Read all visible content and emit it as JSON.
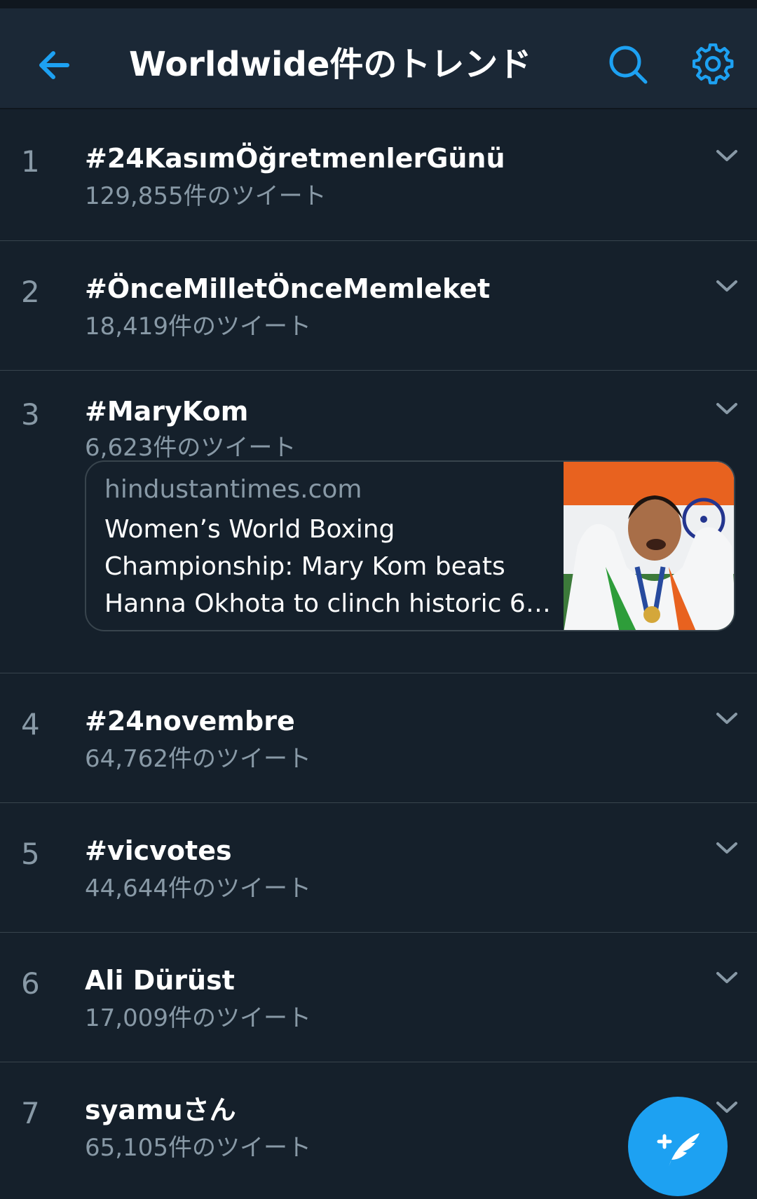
{
  "header": {
    "title": "Worldwide件のトレンド",
    "back_icon": "arrow-left-icon",
    "search_icon": "search-icon",
    "settings_icon": "gear-icon"
  },
  "accent_color": "#1da1f2",
  "trends": [
    {
      "rank": "1",
      "name": "#24KasımÖğretmenlerGünü",
      "count": "129,855件のツイート"
    },
    {
      "rank": "2",
      "name": "#ÖnceMilletÖnceMemleket",
      "count": "18,419件のツイート"
    },
    {
      "rank": "3",
      "name": "#MaryKom",
      "count": "6,623件のツイート"
    },
    {
      "rank": "4",
      "name": "#24novembre",
      "count": "64,762件のツイート"
    },
    {
      "rank": "5",
      "name": "#vicvotes",
      "count": "44,644件のツイート"
    },
    {
      "rank": "6",
      "name": "Ali Dürüst",
      "count": "17,009件のツイート"
    },
    {
      "rank": "7",
      "name": "syamuさん",
      "count": "65,105件のツイート"
    }
  ],
  "news_card": {
    "domain": "hindustantimes.com",
    "headline_lines": [
      "Women’s World Boxing",
      "Championship: Mary Kom beats",
      "Hanna Okhota to clinch historic 6…"
    ]
  },
  "fab": {
    "icon": "compose-tweet-icon"
  }
}
